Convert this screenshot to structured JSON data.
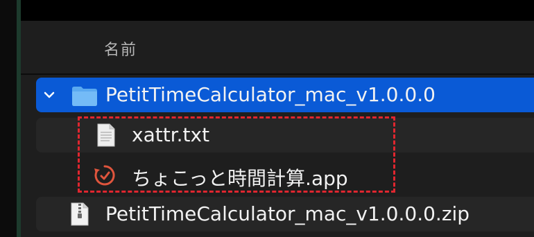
{
  "header": {
    "name_column_label": "名前"
  },
  "files": [
    {
      "name": "PetitTimeCalculator_mac_v1.0.0.0",
      "kind": "folder",
      "expanded": true,
      "selected": true
    },
    {
      "name": "xattr.txt",
      "kind": "text-document"
    },
    {
      "name": "ちょこっと時間計算.app",
      "kind": "application"
    },
    {
      "name": "PetitTimeCalculator_mac_v1.0.0.0.zip",
      "kind": "zip-archive"
    }
  ],
  "colors": {
    "selection": "#0a5ad6",
    "highlight_border": "#e0262f",
    "folder": "#5aa9f0",
    "app_icon": "#e0553d"
  }
}
